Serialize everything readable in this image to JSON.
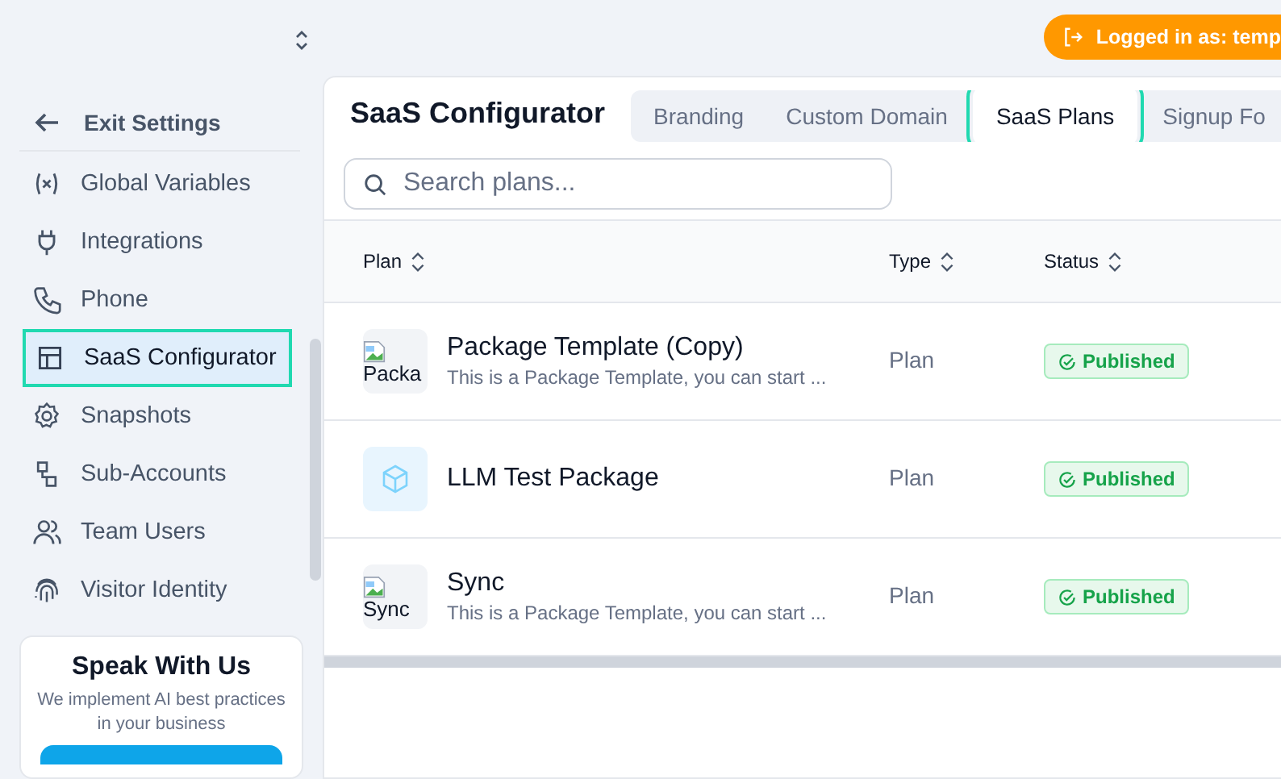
{
  "top_bar": {
    "login_badge": "Logged in as: temp"
  },
  "sidebar": {
    "exit": "Exit Settings",
    "items": [
      {
        "label": "Global Variables",
        "selected": false
      },
      {
        "label": "Integrations",
        "selected": false
      },
      {
        "label": "Phone",
        "selected": false
      },
      {
        "label": "SaaS Configurator",
        "selected": true
      },
      {
        "label": "Snapshots",
        "selected": false
      },
      {
        "label": "Sub-Accounts",
        "selected": false
      },
      {
        "label": "Team Users",
        "selected": false
      },
      {
        "label": "Visitor Identity",
        "selected": false
      }
    ],
    "promo": {
      "title": "Speak With Us",
      "text": "We implement AI best practices in your business"
    }
  },
  "page": {
    "title": "SaaS Configurator",
    "tabs": [
      {
        "label": "Branding",
        "selected": false
      },
      {
        "label": "Custom Domain",
        "selected": false
      },
      {
        "label": "SaaS Plans",
        "selected": true
      },
      {
        "label": "Signup Fo",
        "selected": false
      }
    ],
    "search": {
      "placeholder": "Search plans..."
    },
    "table": {
      "columns": [
        "Plan",
        "Type",
        "Status"
      ],
      "rows": [
        {
          "thumb_alt": "Packa",
          "name": "Package Template (Copy)",
          "description": "This is a Package Template, you can start ...",
          "type": "Plan",
          "status": "Published"
        },
        {
          "name": "LLM Test Package",
          "type": "Plan",
          "status": "Published"
        },
        {
          "thumb_alt": "Sync",
          "name": "Sync",
          "description": "This is a Package Template, you can start ...",
          "type": "Plan",
          "status": "Published"
        }
      ]
    }
  }
}
